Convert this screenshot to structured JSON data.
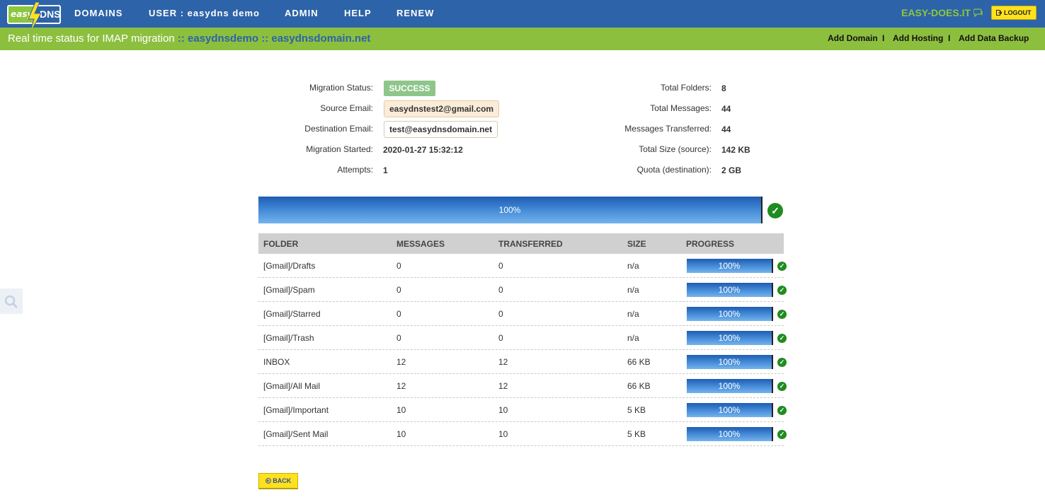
{
  "nav": {
    "logo_easy": "easy",
    "logo_dns": "DNS",
    "items": [
      "DOMAINS",
      "USER : easydns demo",
      "ADMIN",
      "HELP",
      "RENEW"
    ],
    "tagline": "EASY-DOES.IT",
    "logout_label": "LOGOUT"
  },
  "subbar": {
    "title_prefix": "Real time status for IMAP migration",
    "title_user": ":: easydnsdemo",
    "title_domain": ":: easydnsdomain.net",
    "links": [
      "Add Domain",
      "Add Hosting",
      "Add Data Backup"
    ],
    "separator": "I"
  },
  "info": {
    "status_label": "Migration Status:",
    "status_value": "SUCCESS",
    "source_label": "Source Email:",
    "source_value": "easydnstest2@gmail.com",
    "dest_label": "Destination Email:",
    "dest_value": "test@easydnsdomain.net",
    "started_label": "Migration Started:",
    "started_value": "2020-01-27 15:32:12",
    "attempts_label": "Attempts:",
    "attempts_value": "1",
    "folders_label": "Total Folders:",
    "folders_value": "8",
    "messages_label": "Total Messages:",
    "messages_value": "44",
    "transferred_label": "Messages Transferred:",
    "transferred_value": "44",
    "size_label": "Total Size (source):",
    "size_value": "142 KB",
    "quota_label": "Quota (destination):",
    "quota_value": "2 GB"
  },
  "overall_progress": {
    "label": "100%",
    "fraction": 1.0
  },
  "table": {
    "headers": [
      "FOLDER",
      "MESSAGES",
      "TRANSFERRED",
      "SIZE",
      "PROGRESS"
    ],
    "rows": [
      {
        "folder": "[Gmail]/Drafts",
        "messages": "0",
        "transferred": "0",
        "size": "n/a",
        "progress": "100%"
      },
      {
        "folder": "[Gmail]/Spam",
        "messages": "0",
        "transferred": "0",
        "size": "n/a",
        "progress": "100%"
      },
      {
        "folder": "[Gmail]/Starred",
        "messages": "0",
        "transferred": "0",
        "size": "n/a",
        "progress": "100%"
      },
      {
        "folder": "[Gmail]/Trash",
        "messages": "0",
        "transferred": "0",
        "size": "n/a",
        "progress": "100%"
      },
      {
        "folder": "INBOX",
        "messages": "12",
        "transferred": "12",
        "size": "66 KB",
        "progress": "100%"
      },
      {
        "folder": "[Gmail]/All Mail",
        "messages": "12",
        "transferred": "12",
        "size": "66 KB",
        "progress": "100%"
      },
      {
        "folder": "[Gmail]/Important",
        "messages": "10",
        "transferred": "10",
        "size": "5 KB",
        "progress": "100%"
      },
      {
        "folder": "[Gmail]/Sent Mail",
        "messages": "10",
        "transferred": "10",
        "size": "5 KB",
        "progress": "100%"
      }
    ]
  },
  "back_label": "BACK",
  "icons": {
    "logout": "logout-icon",
    "chat": "chat-icon",
    "check": "check-circle-icon",
    "search": "search-icon",
    "back": "back-arrow-icon"
  },
  "colors": {
    "nav_blue": "#2d63a8",
    "accent_green": "#8dbf3f",
    "button_yellow": "#ffe11e",
    "success_green": "#8ec68a",
    "check_green": "#1f8c1f"
  }
}
